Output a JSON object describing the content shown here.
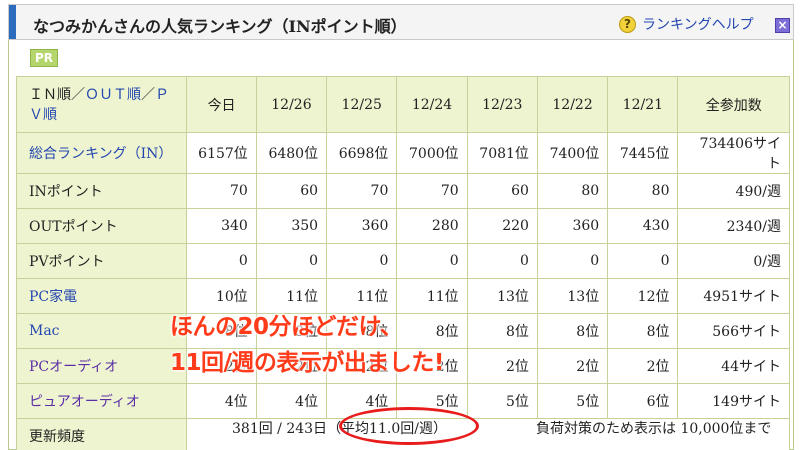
{
  "header": {
    "title": "なつみかんさんの人気ランキング（INポイント順）",
    "help_label": "ランキングヘルプ",
    "help_icon": "?",
    "close_icon": "×"
  },
  "pr_badge": "PR",
  "table": {
    "head": {
      "sort_in": "ＩＮ順",
      "sep1": "／",
      "sort_out": "ＯＵＴ順",
      "sep2": "／",
      "sort_pv": "ＰＶ順",
      "cols": [
        "今日",
        "12/26",
        "12/25",
        "12/24",
        "12/23",
        "12/22",
        "12/21",
        "全参加数"
      ]
    },
    "rows": [
      {
        "label": "総合ランキング（IN）",
        "cells": [
          "6157位",
          "6480位",
          "6698位",
          "7000位",
          "7081位",
          "7400位",
          "7445位",
          "734406サイト"
        ]
      },
      {
        "label": "INポイント",
        "cells": [
          "70",
          "60",
          "70",
          "70",
          "60",
          "80",
          "80",
          "490/週"
        ]
      },
      {
        "label": "OUTポイント",
        "cells": [
          "340",
          "350",
          "360",
          "280",
          "220",
          "360",
          "430",
          "2340/週"
        ]
      },
      {
        "label": "PVポイント",
        "cells": [
          "0",
          "0",
          "0",
          "0",
          "0",
          "0",
          "0",
          "0/週"
        ]
      },
      {
        "label": "PC家電",
        "cells": [
          "10位",
          "11位",
          "11位",
          "11位",
          "13位",
          "13位",
          "12位",
          "4951サイト"
        ]
      },
      {
        "label": "Mac",
        "cells": [
          "8位",
          "8位",
          "8位",
          "8位",
          "8位",
          "8位",
          "8位",
          "566サイト"
        ]
      },
      {
        "label": "PCオーディオ",
        "cells": [
          "2位",
          "2位",
          "2位",
          "2位",
          "2位",
          "2位",
          "2位",
          "44サイト"
        ]
      },
      {
        "label": "ピュアオーディオ",
        "cells": [
          "4位",
          "4位",
          "4位",
          "5位",
          "5位",
          "5位",
          "6位",
          "149サイト"
        ]
      }
    ],
    "footer": {
      "label": "更新頻度",
      "counts": "381回 / 243日",
      "average": "（平均11.0回/週）",
      "note": "負荷対策のため表示は 10,000位まで"
    }
  },
  "overlay": {
    "line1": "ほんの20分ほどだけ、",
    "line2": "11回/週の表示が出ました!"
  },
  "colors": {
    "accent_blue": "#2d6bbd",
    "label_bg": "#eef4cf",
    "annotation_red": "#ff3b1a"
  }
}
